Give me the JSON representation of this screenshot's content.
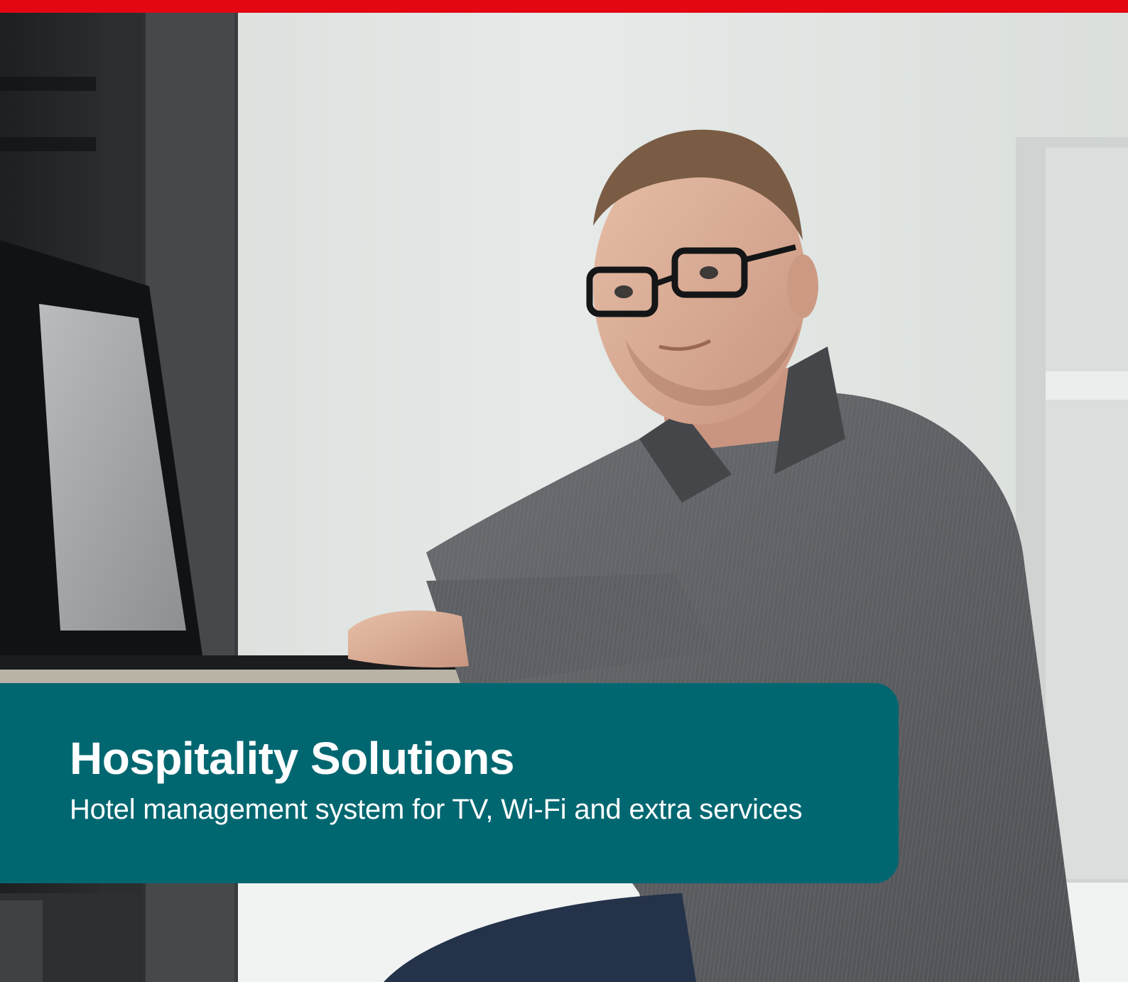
{
  "brand": {
    "accent_color": "#e30613",
    "card_color": "#006771"
  },
  "hero": {
    "title": "Hospitality Solutions",
    "subtitle": "Hotel management system for TV, Wi-Fi and extra services"
  }
}
